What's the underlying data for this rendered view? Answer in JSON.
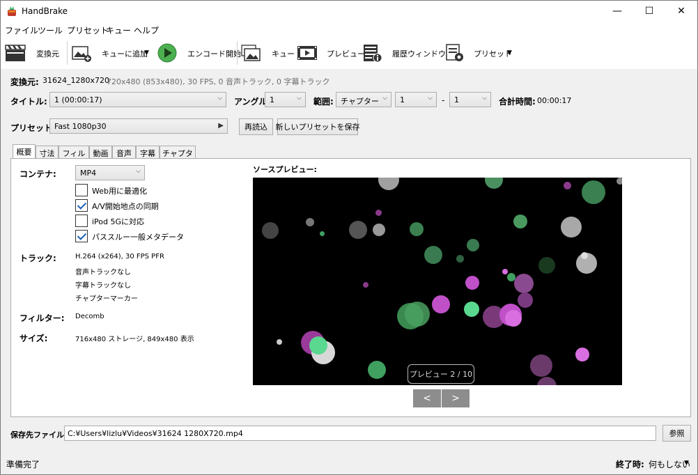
{
  "window": {
    "title": "HandBrake",
    "minimize": "—",
    "maximize": "☐",
    "close": "✕"
  },
  "menu": [
    "ファイル",
    "ツール",
    "プリセット",
    "キュー",
    "ヘルプ"
  ],
  "toolbar": {
    "source": "変換元",
    "add_to_queue": "キューに追加",
    "start_encode": "エンコード開始",
    "queue": "キュー",
    "preview": "プレビュー",
    "activity": "履歴ウィンドウ",
    "presets": "プリセット"
  },
  "source": {
    "label": "変換元:",
    "name": "31624_1280x720",
    "info": "720x480 (853x480), 30 FPS, 0 音声トラック, 0 字幕トラック"
  },
  "title_row": {
    "title_label": "タイトル:",
    "title_value": "1 (00:00:17)",
    "angle_label": "アングル:",
    "angle_value": "1",
    "range_label": "範囲:",
    "range_type": "チャプター",
    "range_start": "1",
    "range_dash": "-",
    "range_end": "1",
    "duration_label": "合計時間:",
    "duration_value": "00:00:17"
  },
  "preset_row": {
    "label": "プリセット:",
    "value": "Fast 1080p30",
    "reload": "再読込",
    "save_new": "新しいプリセットを保存"
  },
  "tabs": [
    "概要",
    "寸法",
    "フィルタ",
    "動画",
    "音声",
    "字幕",
    "チャプター"
  ],
  "summary": {
    "container_label": "コンテナ:",
    "container_value": "MP4",
    "options": [
      {
        "label": "Web用に最適化",
        "checked": false
      },
      {
        "label": "A/V開始地点の同期",
        "checked": true
      },
      {
        "label": "iPod 5Gに対応",
        "checked": false
      },
      {
        "label": "パススルー一般メタデータ",
        "checked": true
      }
    ],
    "tracks_label": "トラック:",
    "tracks": [
      "H.264 (x264), 30 FPS PFR",
      "音声トラックなし",
      "字幕トラックなし",
      "チャプターマーカー"
    ],
    "filters_label": "フィルター:",
    "filters_value": "Decomb",
    "size_label": "サイズ:",
    "size_value": "716x480 ストレージ, 849x480 表示",
    "preview_label": "ソースプレビュー:",
    "preview_badge": "プレビュー 2 / 10",
    "prev_btn": "<",
    "next_btn": ">"
  },
  "destination": {
    "label": "保存先ファイル:",
    "path": "C:¥Users¥lizlu¥Videos¥31624 1280X720.mp4",
    "browse": "参照"
  },
  "status": {
    "text": "準備完了",
    "when_done_label": "終了時:",
    "when_done_value": "何もしない"
  },
  "colors": {
    "green_bubble": "#3fa060",
    "pink_bubble": "#d86ee0",
    "gray_bubble": "#cfcfcf",
    "purple_bubble": "#6a3a6a"
  }
}
